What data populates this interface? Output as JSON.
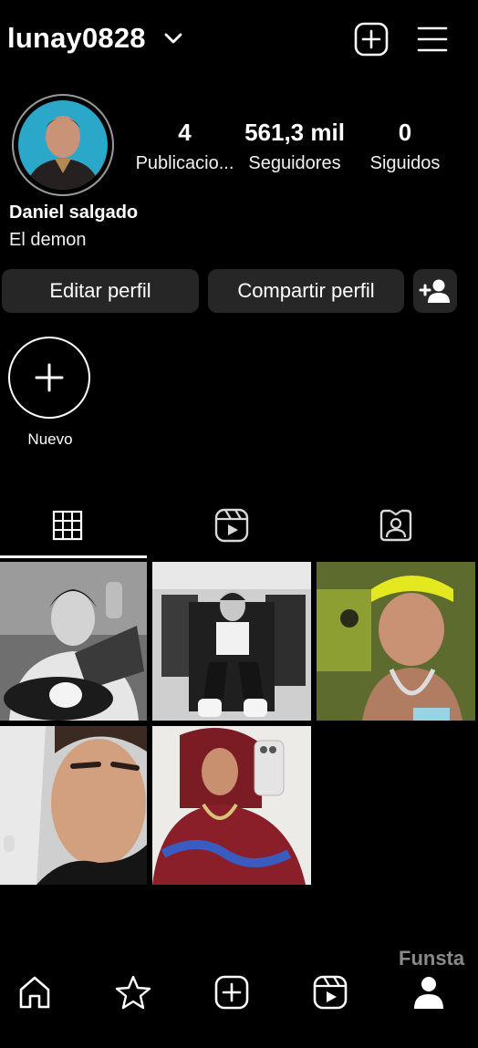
{
  "header": {
    "username": "lunay0828",
    "icons": [
      "chevron-down-icon",
      "plus-square-icon",
      "hamburger-menu-icon"
    ]
  },
  "profile": {
    "full_name": "Daniel salgado",
    "bio": "El demon",
    "stats": [
      {
        "value": "4",
        "label": "Publicacio..."
      },
      {
        "value": "561,3 mil",
        "label": "Seguidores"
      },
      {
        "value": "0",
        "label": "Siguidos"
      }
    ]
  },
  "actions": {
    "edit_label": "Editar perfil",
    "share_label": "Compartir perfil"
  },
  "highlights": {
    "new_label": "Nuevo"
  },
  "tabs": [
    "grid-icon",
    "reels-icon",
    "tagged-icon"
  ],
  "watermark": "Funsta",
  "bottom_nav": [
    "home-icon",
    "star-icon",
    "create-icon",
    "reels-icon",
    "profile-icon"
  ],
  "colors": {
    "background": "#000000",
    "button_bg": "#262626",
    "text": "#ffffff",
    "watermark": "#8a8a8a"
  }
}
